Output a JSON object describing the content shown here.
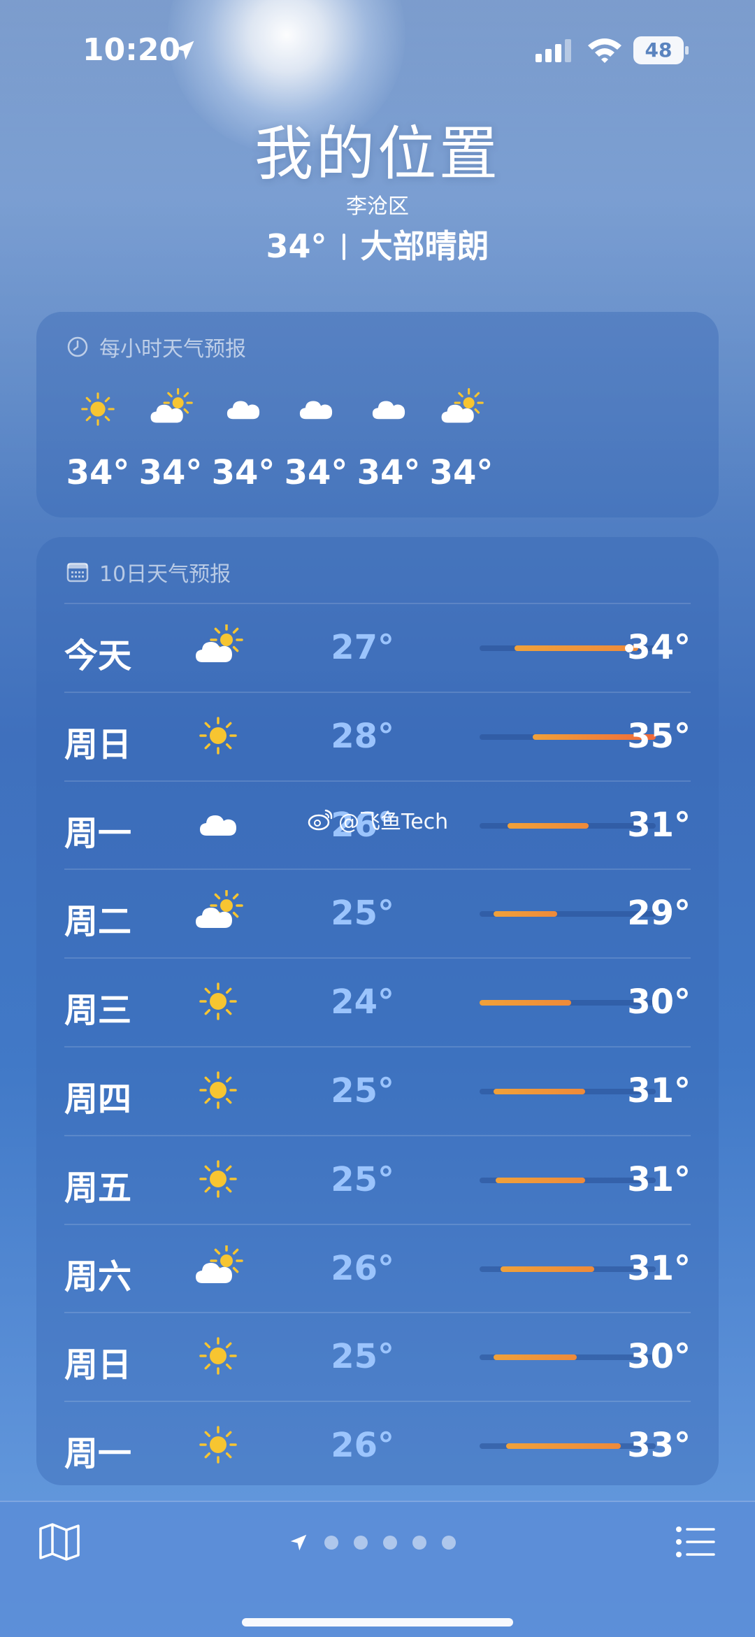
{
  "statusbar": {
    "time": "10:20",
    "battery": "48"
  },
  "header": {
    "title": "我的位置",
    "district": "李沧区",
    "temp": "34°",
    "condition": "大部晴朗"
  },
  "hourly": {
    "label": "每小时天气预报",
    "items": [
      {
        "icon": "sun-icon",
        "temp": "34°"
      },
      {
        "icon": "partly-sunny-icon",
        "temp": "34°"
      },
      {
        "icon": "cloud-icon",
        "temp": "34°"
      },
      {
        "icon": "cloud-icon",
        "temp": "34°"
      },
      {
        "icon": "cloud-icon",
        "temp": "34°"
      },
      {
        "icon": "partly-sunny-icon",
        "temp": "34°"
      }
    ]
  },
  "daily": {
    "label": "10日天气预报",
    "items": [
      {
        "day": "今天",
        "icon": "partly-sunny-icon",
        "low": "27°",
        "high": "34°",
        "bar_start": 0.2,
        "bar_end": 0.9,
        "current_marker": 0.85
      },
      {
        "day": "周日",
        "icon": "sun-icon",
        "low": "28°",
        "high": "35°",
        "bar_start": 0.3,
        "bar_end": 1.0
      },
      {
        "day": "周一",
        "icon": "cloud-icon",
        "low": "26°",
        "high": "31°",
        "bar_start": 0.16,
        "bar_end": 0.62
      },
      {
        "day": "周二",
        "icon": "partly-sunny-icon",
        "low": "25°",
        "high": "29°",
        "bar_start": 0.08,
        "bar_end": 0.44
      },
      {
        "day": "周三",
        "icon": "sun-icon",
        "low": "24°",
        "high": "30°",
        "bar_start": 0.0,
        "bar_end": 0.52
      },
      {
        "day": "周四",
        "icon": "sun-icon",
        "low": "25°",
        "high": "31°",
        "bar_start": 0.08,
        "bar_end": 0.6
      },
      {
        "day": "周五",
        "icon": "sun-icon",
        "low": "25°",
        "high": "31°",
        "bar_start": 0.09,
        "bar_end": 0.6
      },
      {
        "day": "周六",
        "icon": "partly-sunny-icon",
        "low": "26°",
        "high": "31°",
        "bar_start": 0.12,
        "bar_end": 0.65
      },
      {
        "day": "周日",
        "icon": "sun-icon",
        "low": "25°",
        "high": "30°",
        "bar_start": 0.08,
        "bar_end": 0.55
      },
      {
        "day": "周一",
        "icon": "sun-icon",
        "low": "26°",
        "high": "33°",
        "bar_start": 0.15,
        "bar_end": 0.8
      }
    ]
  },
  "watermark": "@飞鱼Tech",
  "colors": {
    "bar_orange": "#f0a13a",
    "bar_red": "#f06a3a",
    "low_temp": "#a0c8ff"
  },
  "bottombar": {
    "page_dots": 5
  }
}
